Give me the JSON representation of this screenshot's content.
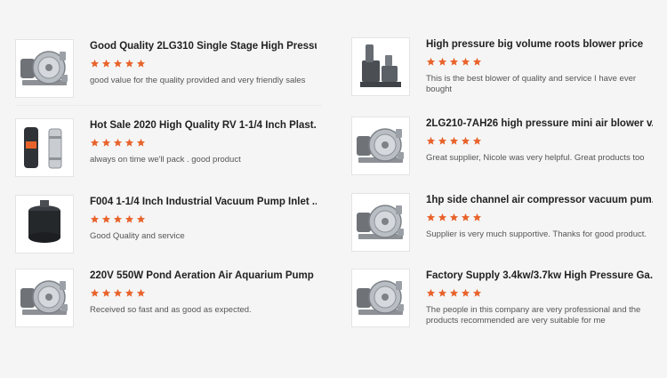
{
  "rating_color": "#e8632b",
  "reviews_left": [
    {
      "title": "Good Quality 2LG310 Single Stage High Pressu...",
      "rating": 5,
      "comment": "good value for the quality provided and very friendly sales",
      "icon": "ring-blower-icon"
    },
    {
      "title": "Hot Sale 2020 High Quality RV 1-1/4 Inch Plast...",
      "rating": 5,
      "comment": "always on time we'll pack . good product",
      "icon": "valve-icon"
    },
    {
      "title": "F004 1-1/4 Inch Industrial Vacuum Pump Inlet ...",
      "rating": 5,
      "comment": "Good Quality and service",
      "icon": "filter-icon"
    },
    {
      "title": "220V 550W Pond Aeration Air Aquarium Pump ...",
      "rating": 5,
      "comment": "Received so fast and as good as expected.",
      "icon": "ring-blower-icon"
    }
  ],
  "reviews_right": [
    {
      "title": "High pressure big volume roots blower price",
      "rating": 5,
      "comment": "This is the best blower of quality and service I have ever bought",
      "icon": "roots-blower-icon"
    },
    {
      "title": "2LG210-7AH26 high pressure mini air blower v...",
      "rating": 5,
      "comment": "Great supplier, Nicole was very helpful. Great products too",
      "icon": "ring-blower-icon"
    },
    {
      "title": "1hp side channel air compressor vacuum pum...",
      "rating": 5,
      "comment": "Supplier is very much supportive. Thanks for good product.",
      "icon": "ring-blower-icon"
    },
    {
      "title": "Factory Supply 3.4kw/3.7kw High Pressure Ga...",
      "rating": 5,
      "comment": "The people in this company are very professional and the products recommended are very suitable for me",
      "icon": "ring-blower-icon"
    }
  ]
}
